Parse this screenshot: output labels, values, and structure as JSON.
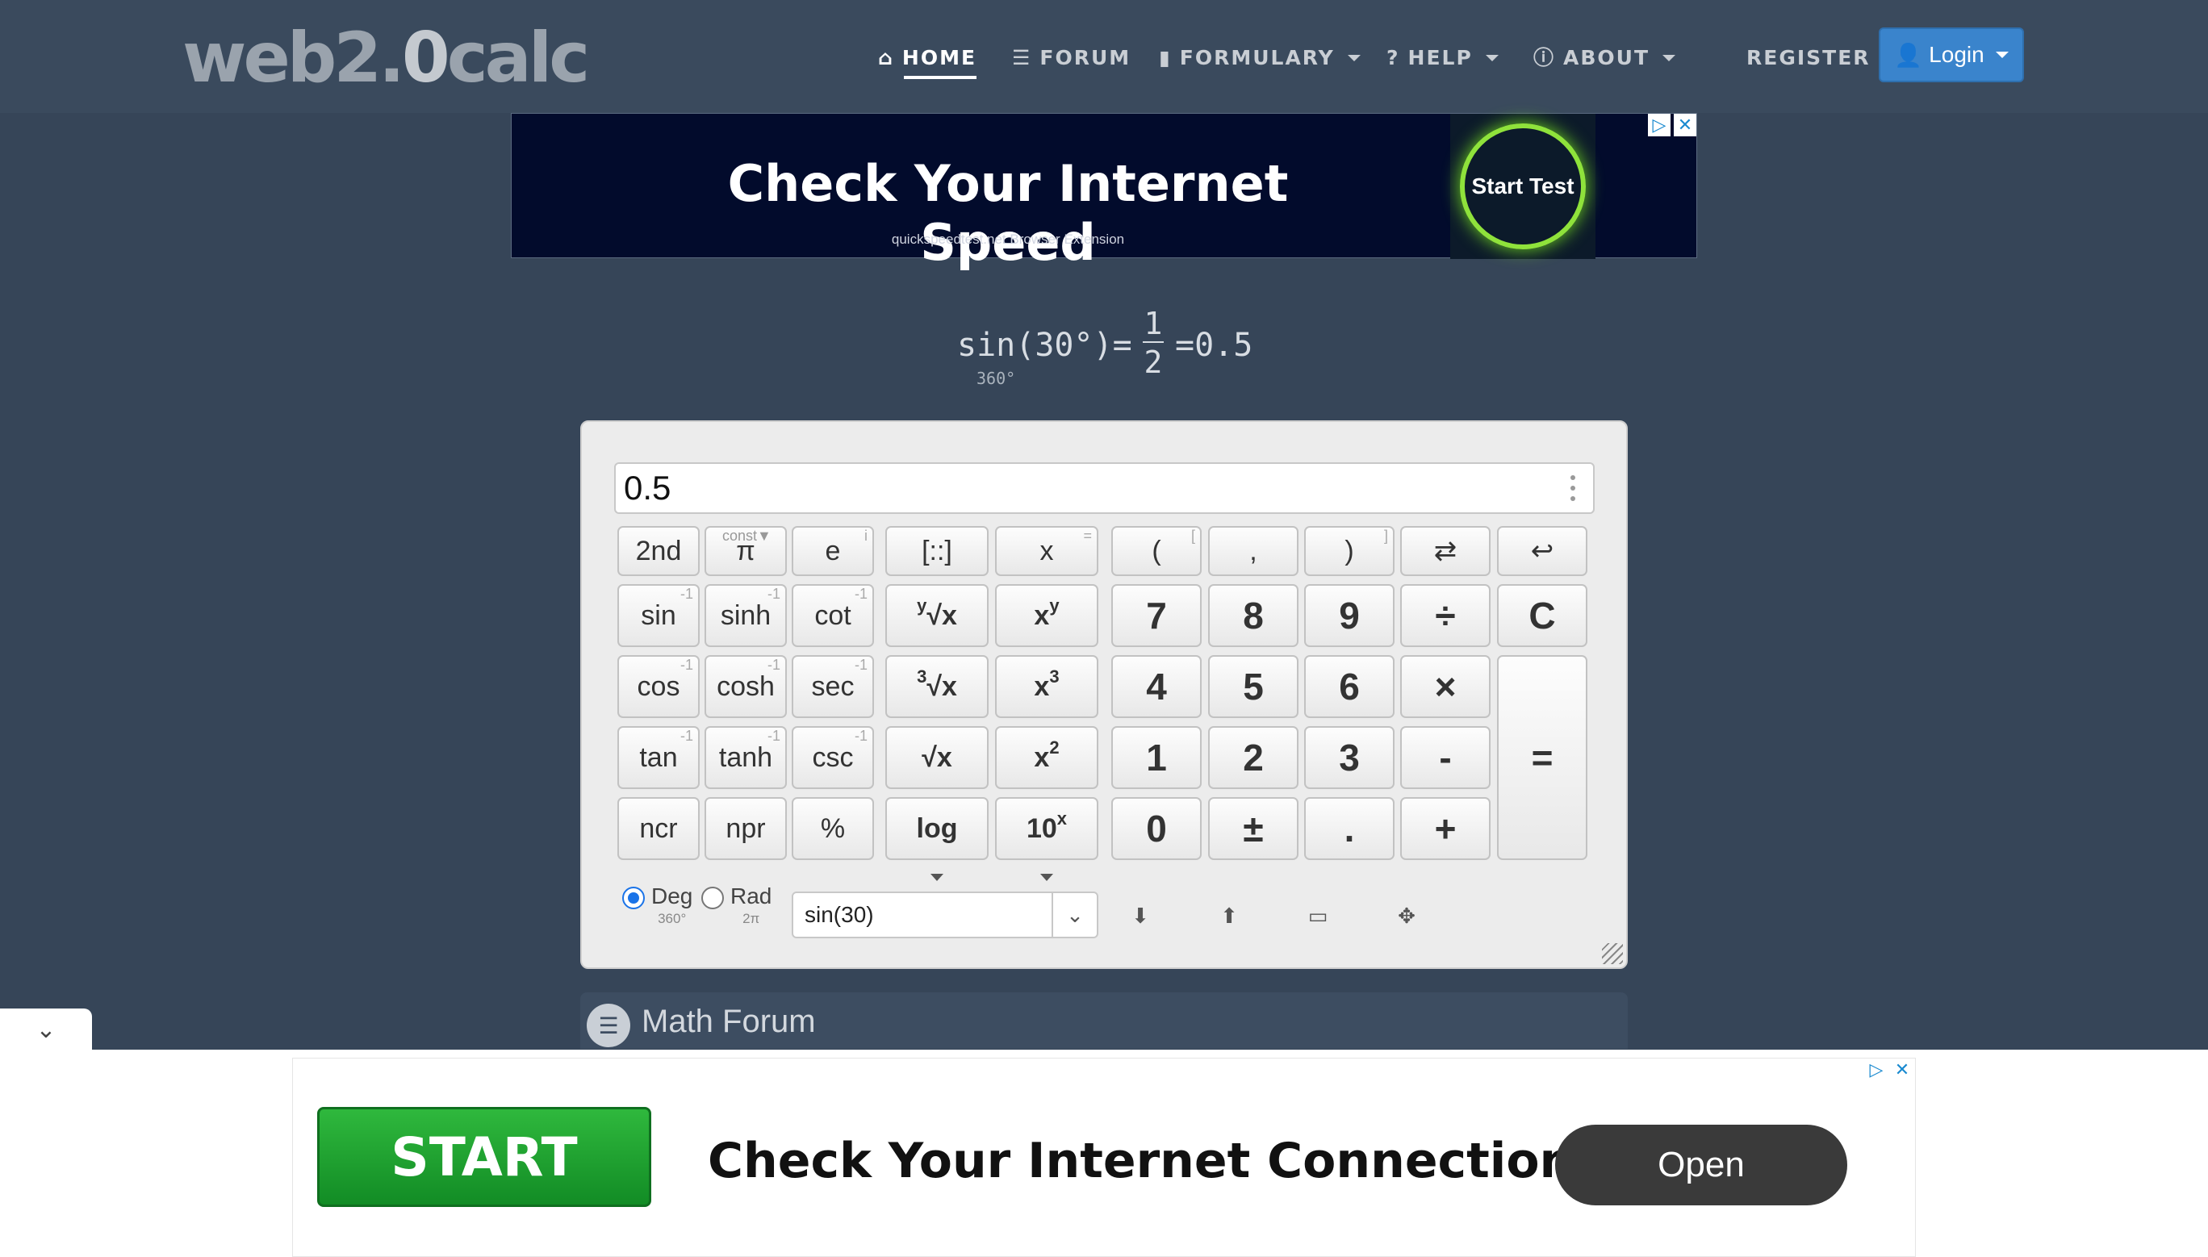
{
  "logo": {
    "text_main": "web2.",
    "text_bold": "0",
    "text_end": "calc"
  },
  "nav": {
    "home": "HOME",
    "forum": "FORUM",
    "formulary": "FORMULARY",
    "help": "HELP",
    "about": "ABOUT",
    "register": "REGISTER",
    "login": "Login"
  },
  "top_ad": {
    "headline": "Check Your Internet Speed",
    "sub": "quickspeedtest.net Browser Extension",
    "cta": "Start Test"
  },
  "equation": {
    "lhs": "sin(30°)=",
    "num": "1",
    "den": "2",
    "result": "=0.5",
    "deg_label": "360°"
  },
  "calculator": {
    "display_value": "0.5",
    "keys": {
      "second": "2nd",
      "const": "const▼",
      "pi": "π",
      "e": "e",
      "e_sup": "i",
      "matrix": "[::]",
      "x": "x",
      "x_sup": "=",
      "lparen": "(",
      "lparen_sup": "[",
      "comma": ",",
      "rparen": ")",
      "rparen_sup": "]",
      "swap": "⇄",
      "back": "↩",
      "sin": "sin",
      "sinh": "sinh",
      "cot": "cot",
      "yroot_pre": "y",
      "yroot": "√x",
      "xpow": "x",
      "xpow_sup": "y",
      "n7": "7",
      "n8": "8",
      "n9": "9",
      "div": "÷",
      "clear": "C",
      "cos": "cos",
      "cosh": "cosh",
      "sec": "sec",
      "croot_pre": "3",
      "croot": "√x",
      "xcube": "x",
      "xcube_sup": "3",
      "n4": "4",
      "n5": "5",
      "n6": "6",
      "mul": "×",
      "equals": "=",
      "tan": "tan",
      "tanh": "tanh",
      "csc": "csc",
      "sqrt": "√x",
      "xsq": "x",
      "xsq_sup": "2",
      "n1": "1",
      "n2": "2",
      "n3": "3",
      "minus": "-",
      "ncr": "ncr",
      "npr": "npr",
      "percent": "%",
      "log": "log",
      "ten": "10",
      "ten_sup": "x",
      "n0": "0",
      "plusminus": "±",
      "dot": ".",
      "plus": "+",
      "inv": "-1"
    },
    "mode": {
      "deg": "Deg",
      "deg_sub": "360°",
      "rad": "Rad",
      "rad_sub": "2π",
      "selected": "deg"
    },
    "history_value": "sin(30)",
    "tool_icons": [
      "arrow-down-icon",
      "arrow-up-icon",
      "minimize-icon",
      "move-icon"
    ]
  },
  "forum": {
    "title": "Math Forum"
  },
  "bottom_ad": {
    "start": "START",
    "headline": "Check Your Internet Connection",
    "open": "Open"
  },
  "colors": {
    "background": "#364558",
    "navbar": "#3a4a5d",
    "login": "#3a84cc",
    "start_green": "#1fa22f"
  }
}
